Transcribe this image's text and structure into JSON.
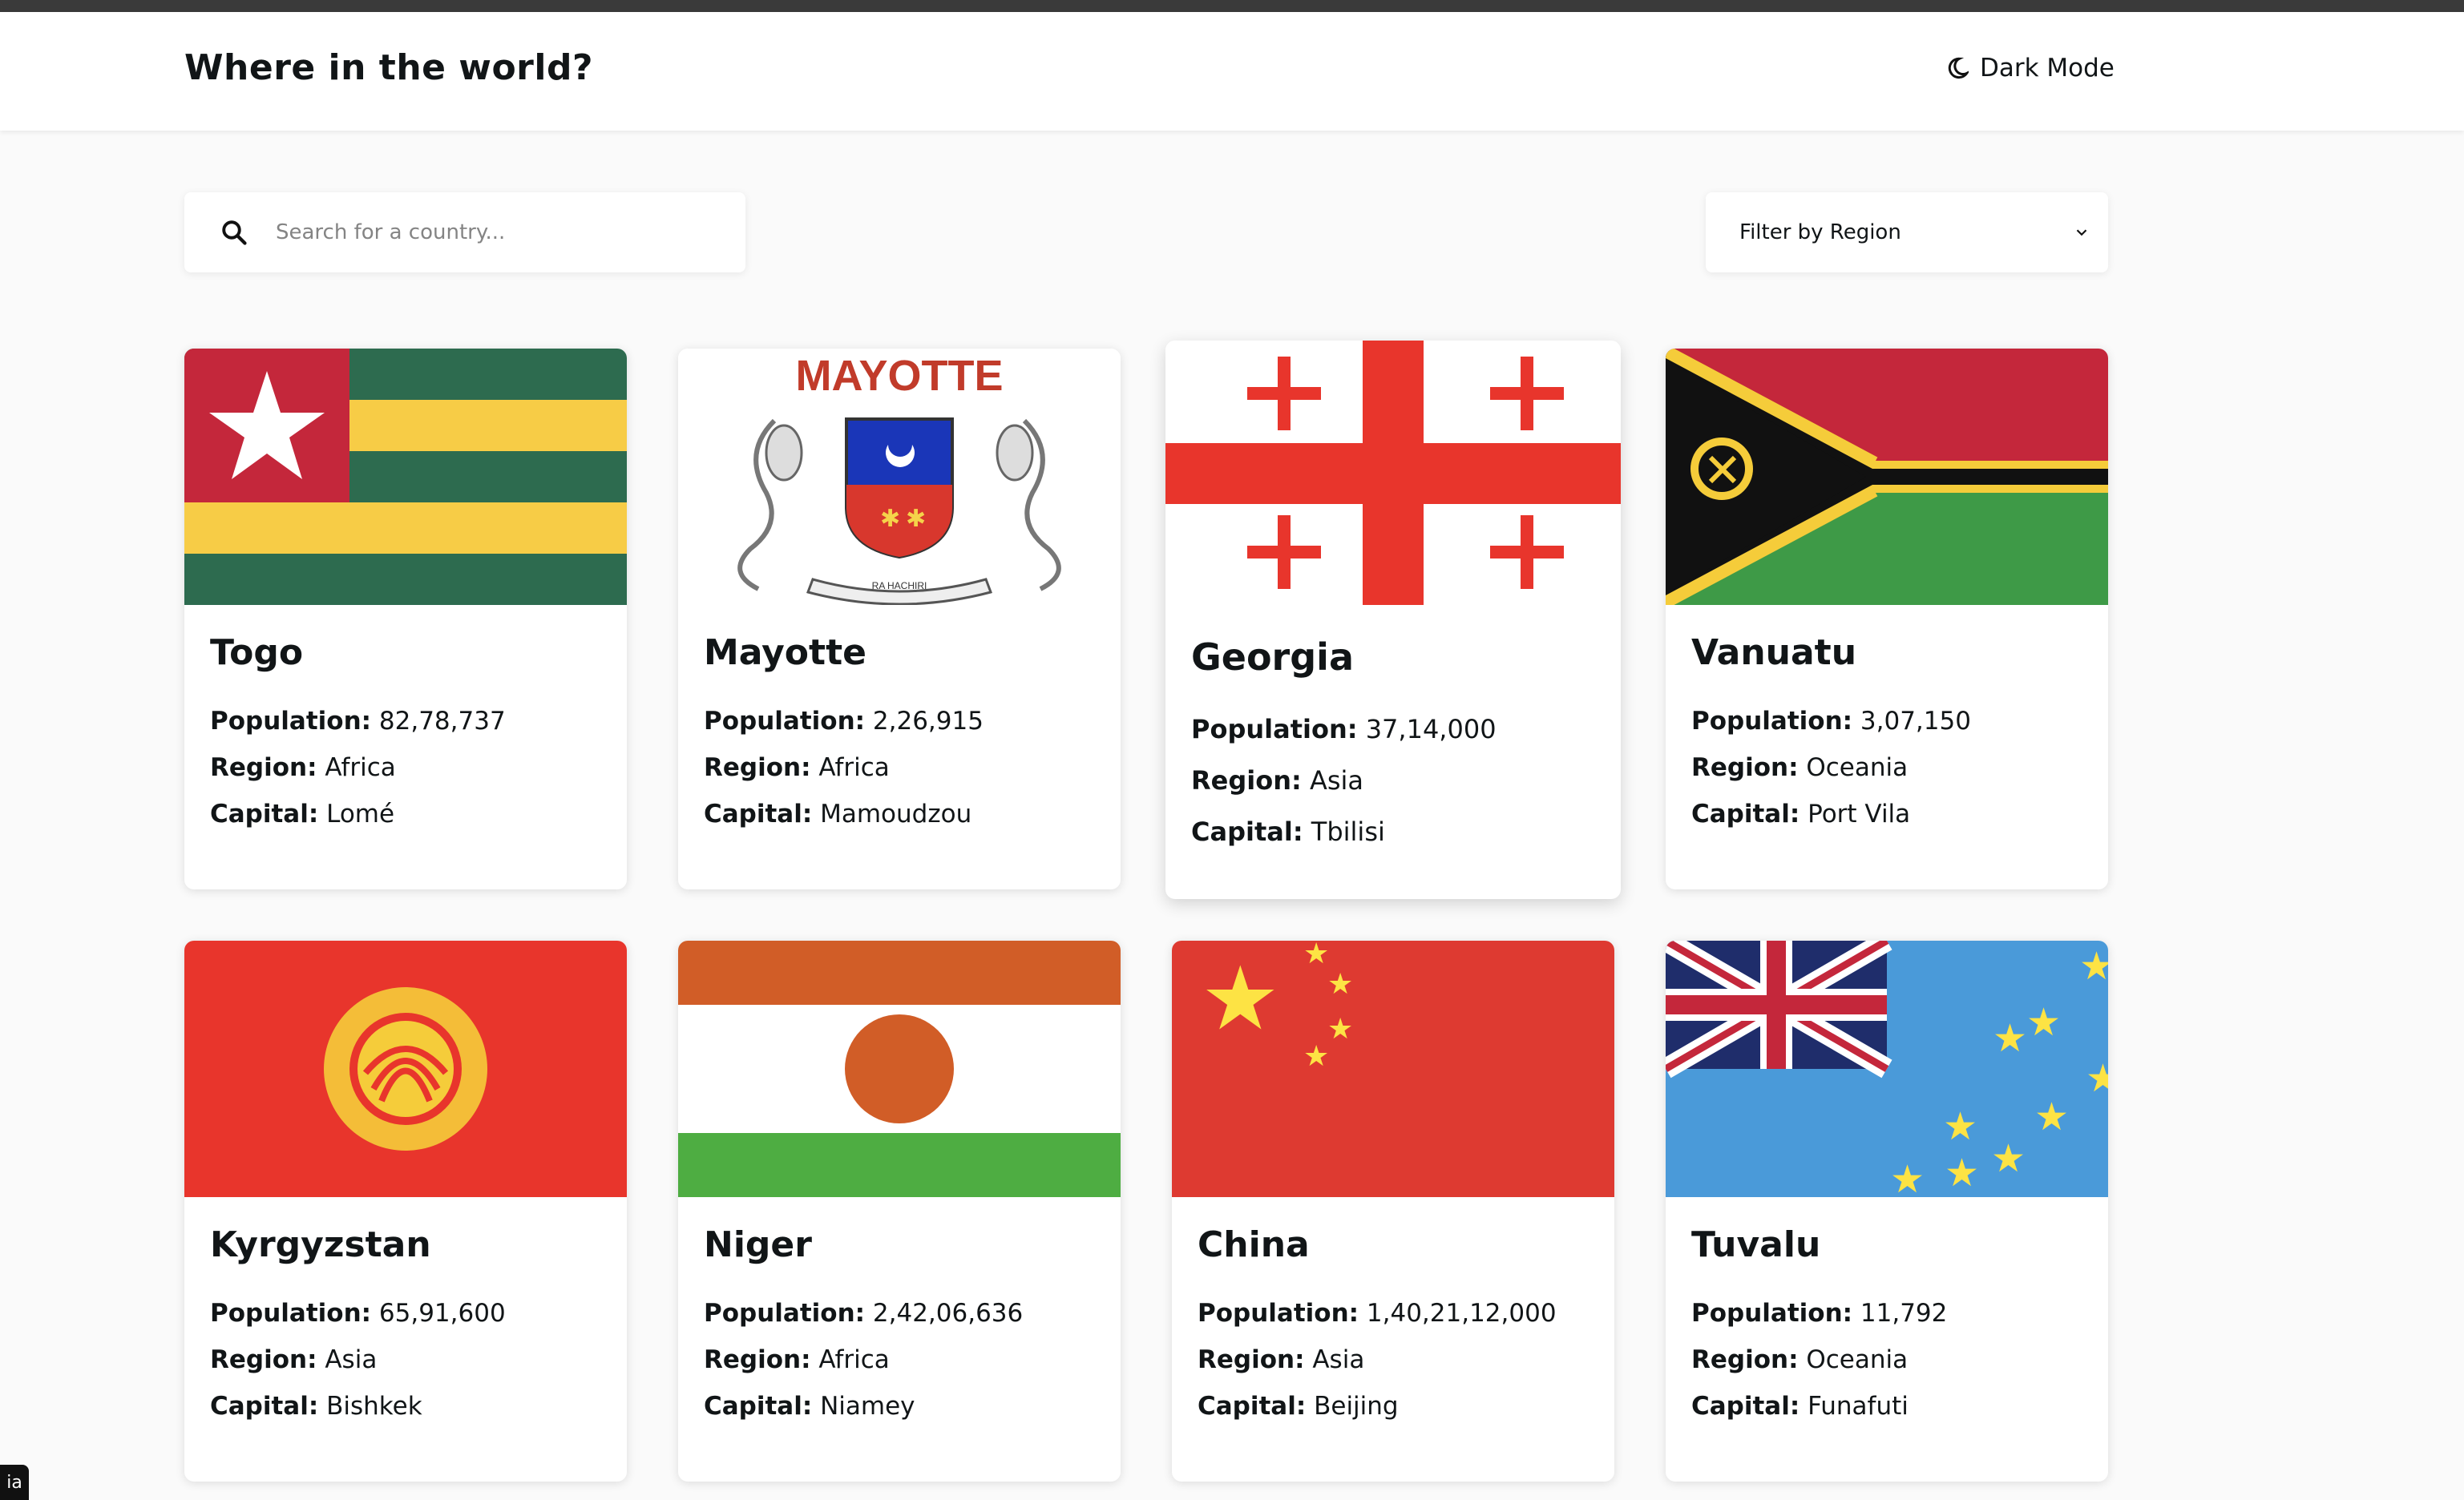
{
  "header": {
    "title": "Where in the world?",
    "toggle_label": "Dark Mode",
    "toggle_icon": "moon-icon"
  },
  "search": {
    "placeholder": "Search for a country...",
    "value": ""
  },
  "filter": {
    "label": "Filter by Region"
  },
  "labels": {
    "population": "Population:",
    "region": "Region:",
    "capital": "Capital:"
  },
  "countries": [
    {
      "name": "Togo",
      "population": "82,78,737",
      "region": "Africa",
      "capital": "Lomé",
      "flag": "togo-flag"
    },
    {
      "name": "Mayotte",
      "population": "2,26,915",
      "region": "Africa",
      "capital": "Mamoudzou",
      "flag": "mayotte-flag",
      "flag_text": "MAYOTTE",
      "motto": "RA HACHIRI"
    },
    {
      "name": "Georgia",
      "population": "37,14,000",
      "region": "Asia",
      "capital": "Tbilisi",
      "flag": "georgia-flag"
    },
    {
      "name": "Vanuatu",
      "population": "3,07,150",
      "region": "Oceania",
      "capital": "Port Vila",
      "flag": "vanuatu-flag"
    },
    {
      "name": "Kyrgyzstan",
      "population": "65,91,600",
      "region": "Asia",
      "capital": "Bishkek",
      "flag": "kyrgyzstan-flag"
    },
    {
      "name": "Niger",
      "population": "2,42,06,636",
      "region": "Africa",
      "capital": "Niamey",
      "flag": "niger-flag"
    },
    {
      "name": "China",
      "population": "1,40,21,12,000",
      "region": "Asia",
      "capital": "Beijing",
      "flag": "china-flag"
    },
    {
      "name": "Tuvalu",
      "population": "11,792",
      "region": "Oceania",
      "capital": "Funafuti",
      "flag": "tuvalu-flag"
    }
  ],
  "corner_badge": "ia",
  "colors": {
    "background": "#fafafa",
    "card": "#ffffff",
    "text": "#111517"
  }
}
